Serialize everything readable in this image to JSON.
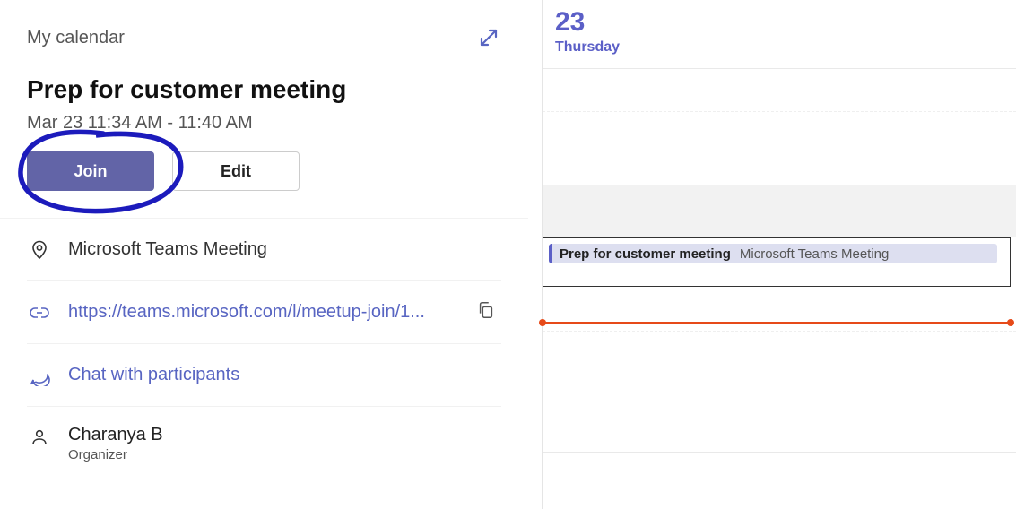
{
  "header": {
    "label": "My calendar"
  },
  "event": {
    "title": "Prep for customer meeting",
    "time": "Mar 23 11:34 AM - 11:40 AM"
  },
  "buttons": {
    "join": "Join",
    "edit": "Edit"
  },
  "details": {
    "location": "Microsoft Teams Meeting",
    "link": "https://teams.microsoft.com/l/meetup-join/1...",
    "chat": "Chat with participants"
  },
  "organizer": {
    "name": "Charanya B",
    "role": "Organizer"
  },
  "calendar": {
    "daynum": "23",
    "dayname": "Thursday",
    "event_title": "Prep for customer meeting",
    "event_sub": "Microsoft Teams Meeting"
  }
}
